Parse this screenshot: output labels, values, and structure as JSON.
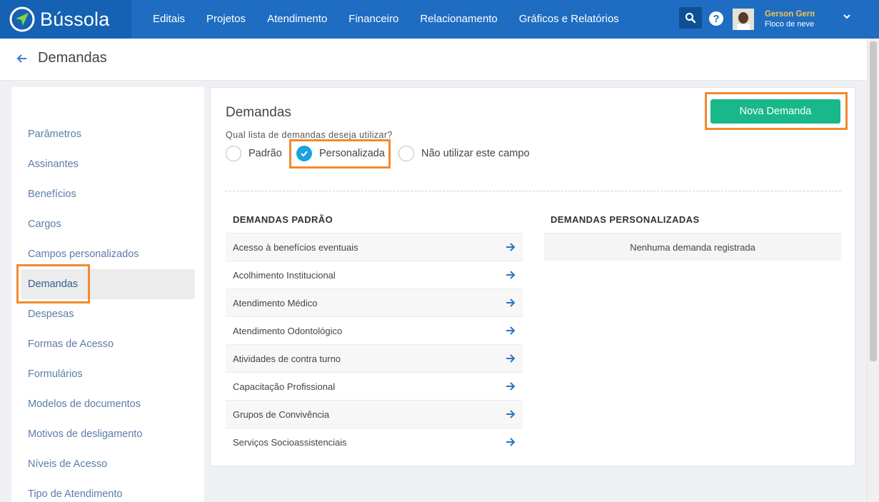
{
  "app": {
    "brand": "Bússola"
  },
  "nav": {
    "items": [
      "Editais",
      "Projetos",
      "Atendimento",
      "Financeiro",
      "Relacionamento",
      "Gráficos e Relatórios"
    ]
  },
  "user": {
    "name": "Gerson German",
    "org": "Floco de neve"
  },
  "page": {
    "title": "Demandas"
  },
  "sidebar": {
    "items": [
      "Parâmetros",
      "Assinantes",
      "Benefícios",
      "Cargos",
      "Campos personalizados",
      "Demandas",
      "Despesas",
      "Formas de Acesso",
      "Formulários",
      "Modelos de documentos",
      "Motivos de desligamento",
      "Níveis de Acesso",
      "Tipo de Atendimento"
    ],
    "active": "Demandas"
  },
  "main": {
    "title": "Demandas",
    "question": "Qual lista de demandas deseja utilizar?",
    "options": [
      "Padrão",
      "Personalizada",
      "Não utilizar este campo"
    ],
    "selected_option": "Personalizada",
    "new_button": "Nova Demanda",
    "padrao_heading": "DEMANDAS PADRÃO",
    "padrao_items": [
      "Acesso à benefícios eventuais",
      "Acolhimento Institucional",
      "Atendimento Médico",
      "Atendimento Odontológico",
      "Atividades de contra turno",
      "Capacitação Profissional",
      "Grupos de Convivência",
      "Serviços Socioassistenciais"
    ],
    "custom_heading": "DEMANDAS PERSONALIZADAS",
    "custom_empty": "Nenhuma demanda registrada"
  },
  "colors": {
    "primary": "#1f6dc2",
    "accent_green": "#19b88a",
    "highlight": "#f28a2e",
    "radio_checked": "#1aa3dd"
  }
}
